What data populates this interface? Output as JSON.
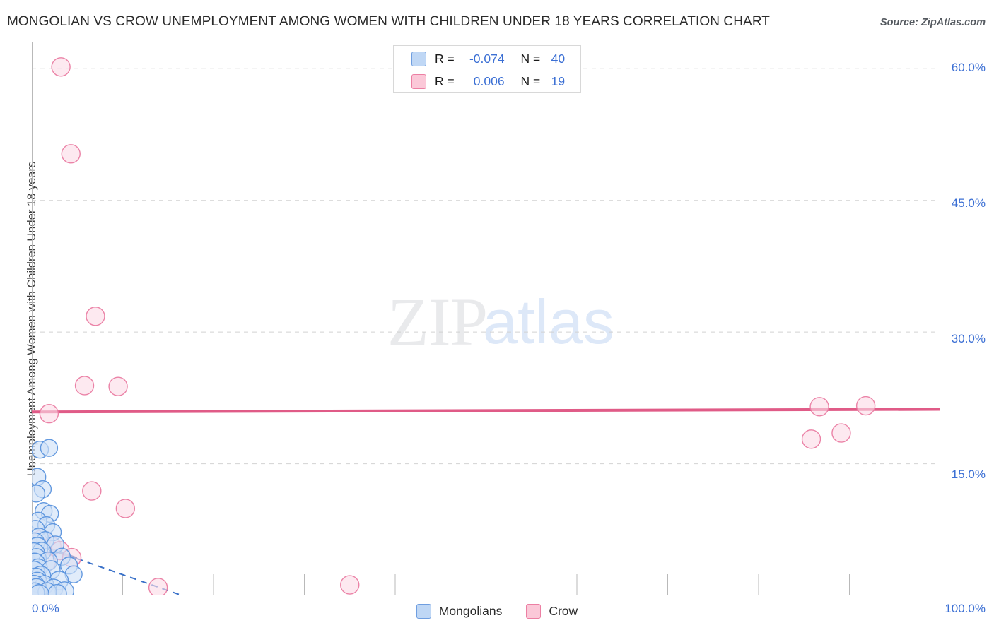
{
  "header": {
    "title": "MONGOLIAN VS CROW UNEMPLOYMENT AMONG WOMEN WITH CHILDREN UNDER 18 YEARS CORRELATION CHART",
    "source": "Source: ZipAtlas.com"
  },
  "watermark": {
    "part1": "ZIP",
    "part2": "atlas"
  },
  "stats": {
    "rows": [
      {
        "series": "Mongolians",
        "color": "#bfd7f5",
        "r_label": "R = ",
        "r_value": "-0.074",
        "n_label": "N = ",
        "n_value": "40"
      },
      {
        "series": "Crow",
        "color": "#fbc8d8",
        "r_label": "R = ",
        "r_value": "0.006",
        "n_label": "N = ",
        "n_value": "19"
      }
    ]
  },
  "legend": {
    "items": [
      {
        "label": "Mongolians",
        "color": "#bfd7f5",
        "border": "#6f9ee0"
      },
      {
        "label": "Crow",
        "color": "#fbc8d8",
        "border": "#ec7fa3"
      }
    ]
  },
  "axes": {
    "y_title": "Unemployment Among Women with Children Under 18 years",
    "y_ticks": [
      {
        "label": "60.0%",
        "value": 60
      },
      {
        "label": "45.0%",
        "value": 45
      },
      {
        "label": "30.0%",
        "value": 30
      },
      {
        "label": "15.0%",
        "value": 15
      }
    ],
    "x_ticks": [
      {
        "label": "0.0%",
        "value": 0
      },
      {
        "label": "100.0%",
        "value": 100
      }
    ]
  },
  "chart_data": {
    "type": "scatter",
    "title": "MONGOLIAN VS CROW UNEMPLOYMENT AMONG WOMEN WITH CHILDREN UNDER 18 YEARS CORRELATION CHART",
    "xlabel": "",
    "ylabel": "Unemployment Among Women with Children Under 18 years",
    "xlim": [
      0,
      100
    ],
    "ylim": [
      0,
      63
    ],
    "grid": true,
    "legend_position": "bottom-center",
    "colors": {
      "mongolians_fill": "#cfe0f7",
      "mongolians_stroke": "#5b93dd",
      "crow_fill": "#fbdce6",
      "crow_stroke": "#ea7ca2",
      "axis_text": "#3b6fd4"
    },
    "series": [
      {
        "name": "Mongolians",
        "r": -0.074,
        "n": 40,
        "fill": "#cfe0f7",
        "stroke": "#5b93dd",
        "trendline": {
          "style": "solid-then-dashed",
          "x1": 0,
          "y1": 6.0,
          "x2": 16.5,
          "y2": 0.0
        },
        "points": [
          {
            "x": 0.9,
            "y": 16.6,
            "r": 12
          },
          {
            "x": 1.9,
            "y": 16.8,
            "r": 12
          },
          {
            "x": 0.6,
            "y": 13.5,
            "r": 12
          },
          {
            "x": 1.2,
            "y": 12.1,
            "r": 12
          },
          {
            "x": 0.5,
            "y": 11.6,
            "r": 12
          },
          {
            "x": 1.3,
            "y": 9.6,
            "r": 12
          },
          {
            "x": 2.0,
            "y": 9.3,
            "r": 12
          },
          {
            "x": 0.7,
            "y": 8.5,
            "r": 12
          },
          {
            "x": 1.6,
            "y": 8.0,
            "r": 12
          },
          {
            "x": 0.4,
            "y": 7.5,
            "r": 13
          },
          {
            "x": 2.3,
            "y": 7.2,
            "r": 12
          },
          {
            "x": 0.8,
            "y": 6.6,
            "r": 13
          },
          {
            "x": 1.5,
            "y": 6.3,
            "r": 12
          },
          {
            "x": 0.3,
            "y": 6.0,
            "r": 14
          },
          {
            "x": 2.6,
            "y": 5.8,
            "r": 12
          },
          {
            "x": 0.6,
            "y": 5.4,
            "r": 15
          },
          {
            "x": 1.1,
            "y": 5.0,
            "r": 13
          },
          {
            "x": 0.2,
            "y": 4.7,
            "r": 16
          },
          {
            "x": 3.3,
            "y": 4.4,
            "r": 12
          },
          {
            "x": 0.5,
            "y": 4.2,
            "r": 14
          },
          {
            "x": 1.8,
            "y": 3.9,
            "r": 13
          },
          {
            "x": 0.3,
            "y": 3.6,
            "r": 15
          },
          {
            "x": 4.1,
            "y": 3.4,
            "r": 12
          },
          {
            "x": 0.7,
            "y": 3.1,
            "r": 13
          },
          {
            "x": 2.1,
            "y": 2.9,
            "r": 13
          },
          {
            "x": 0.2,
            "y": 2.6,
            "r": 16
          },
          {
            "x": 4.6,
            "y": 2.4,
            "r": 12
          },
          {
            "x": 1.0,
            "y": 2.2,
            "r": 14
          },
          {
            "x": 0.4,
            "y": 1.9,
            "r": 15
          },
          {
            "x": 3.0,
            "y": 1.7,
            "r": 13
          },
          {
            "x": 0.6,
            "y": 1.5,
            "r": 14
          },
          {
            "x": 1.4,
            "y": 1.2,
            "r": 13
          },
          {
            "x": 0.2,
            "y": 1.0,
            "r": 16
          },
          {
            "x": 2.4,
            "y": 0.8,
            "r": 13
          },
          {
            "x": 0.5,
            "y": 0.7,
            "r": 15
          },
          {
            "x": 3.6,
            "y": 0.5,
            "r": 13
          },
          {
            "x": 1.7,
            "y": 0.4,
            "r": 13
          },
          {
            "x": 0.3,
            "y": 0.3,
            "r": 14
          },
          {
            "x": 2.8,
            "y": 0.2,
            "r": 13
          },
          {
            "x": 0.8,
            "y": 0.1,
            "r": 14
          }
        ]
      },
      {
        "name": "Crow",
        "r": 0.006,
        "n": 19,
        "fill": "#fbdce6",
        "stroke": "#ea7ca2",
        "trendline": {
          "style": "solid",
          "x1": 0,
          "y1": 20.9,
          "x2": 100,
          "y2": 21.2
        },
        "points": [
          {
            "x": 3.2,
            "y": 60.2,
            "r": 13
          },
          {
            "x": 4.3,
            "y": 50.3,
            "r": 13
          },
          {
            "x": 7.0,
            "y": 31.8,
            "r": 13
          },
          {
            "x": 5.8,
            "y": 23.9,
            "r": 13
          },
          {
            "x": 9.5,
            "y": 23.8,
            "r": 13
          },
          {
            "x": 1.9,
            "y": 20.7,
            "r": 13
          },
          {
            "x": 86.7,
            "y": 21.5,
            "r": 13
          },
          {
            "x": 91.8,
            "y": 21.6,
            "r": 13
          },
          {
            "x": 89.1,
            "y": 18.5,
            "r": 13
          },
          {
            "x": 85.8,
            "y": 17.8,
            "r": 13
          },
          {
            "x": 6.6,
            "y": 11.9,
            "r": 13
          },
          {
            "x": 10.3,
            "y": 9.9,
            "r": 13
          },
          {
            "x": 1.1,
            "y": 6.4,
            "r": 13
          },
          {
            "x": 2.2,
            "y": 5.6,
            "r": 13
          },
          {
            "x": 3.1,
            "y": 5.1,
            "r": 13
          },
          {
            "x": 4.4,
            "y": 4.3,
            "r": 13
          },
          {
            "x": 1.6,
            "y": 3.8,
            "r": 13
          },
          {
            "x": 13.9,
            "y": 0.9,
            "r": 13
          },
          {
            "x": 35.0,
            "y": 1.2,
            "r": 13
          }
        ]
      }
    ]
  }
}
